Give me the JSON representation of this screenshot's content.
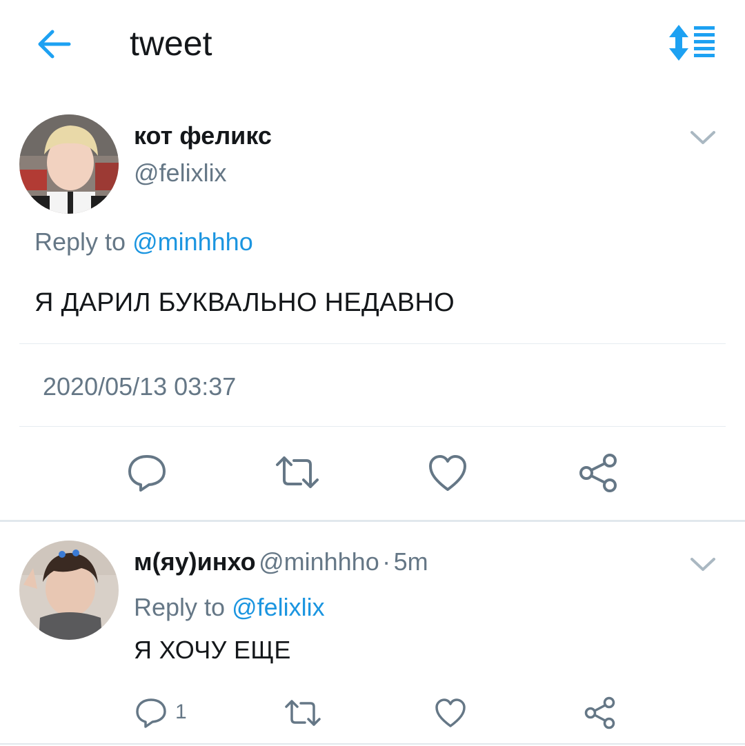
{
  "header": {
    "title": "tweet",
    "back_icon": "arrow-left-icon",
    "sort_icon": "sort-list-icon",
    "accent_color": "#1da1f2"
  },
  "main_tweet": {
    "display_name": "кот феликс",
    "handle": "@felixlix",
    "reply_prefix": "Reply to ",
    "reply_to": "@minhhho",
    "text": "Я ДАРИЛ БУКВАЛЬНО НЕДАВНО",
    "timestamp": "2020/05/13 03:37",
    "actions": [
      "reply-icon",
      "retweet-icon",
      "like-icon",
      "share-icon"
    ]
  },
  "reply_tweet": {
    "display_name": "м(яу)инхо",
    "handle": "@minhhho",
    "separator": "·",
    "time_ago": "5m",
    "reply_prefix": "Reply to ",
    "reply_to": "@felixlix",
    "text": "Я ХОЧУ ЕЩЕ",
    "reply_count": "1",
    "actions": [
      "reply-icon",
      "retweet-icon",
      "like-icon",
      "share-icon"
    ]
  },
  "colors": {
    "link": "#1b95e0",
    "secondary_text": "#657786",
    "primary_text": "#14171a"
  }
}
